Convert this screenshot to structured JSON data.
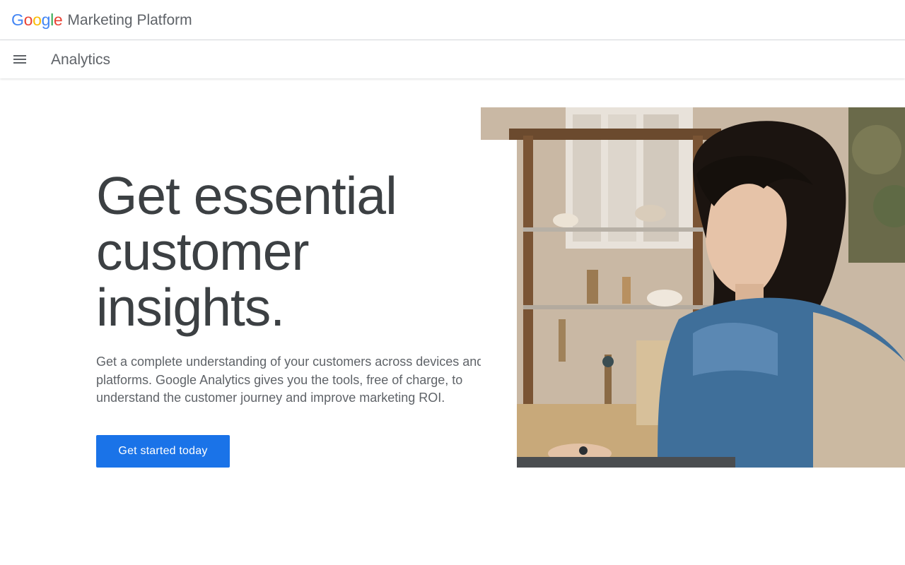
{
  "topbar": {
    "logo_letters": [
      "G",
      "o",
      "o",
      "g",
      "l",
      "e"
    ],
    "logo_colors": [
      "#4285F4",
      "#EA4335",
      "#FBBC05",
      "#4285F4",
      "#34A853",
      "#EA4335"
    ],
    "product_name": "Marketing Platform"
  },
  "navbar": {
    "menu_icon": "menu-icon",
    "title": "Analytics"
  },
  "hero": {
    "heading": "Get essential customer insights.",
    "body": "Get a complete understanding of your customers across devices and platforms. Google Analytics gives you the tools, free of charge, to understand the customer journey and improve marketing ROI.",
    "cta_label": "Get started today",
    "image_alt": "Woman working at a laptop in a shop",
    "colors": {
      "heading": "#3c4043",
      "body": "#5f6368",
      "cta_background": "#1a73e8",
      "cta_text": "#ffffff"
    }
  }
}
